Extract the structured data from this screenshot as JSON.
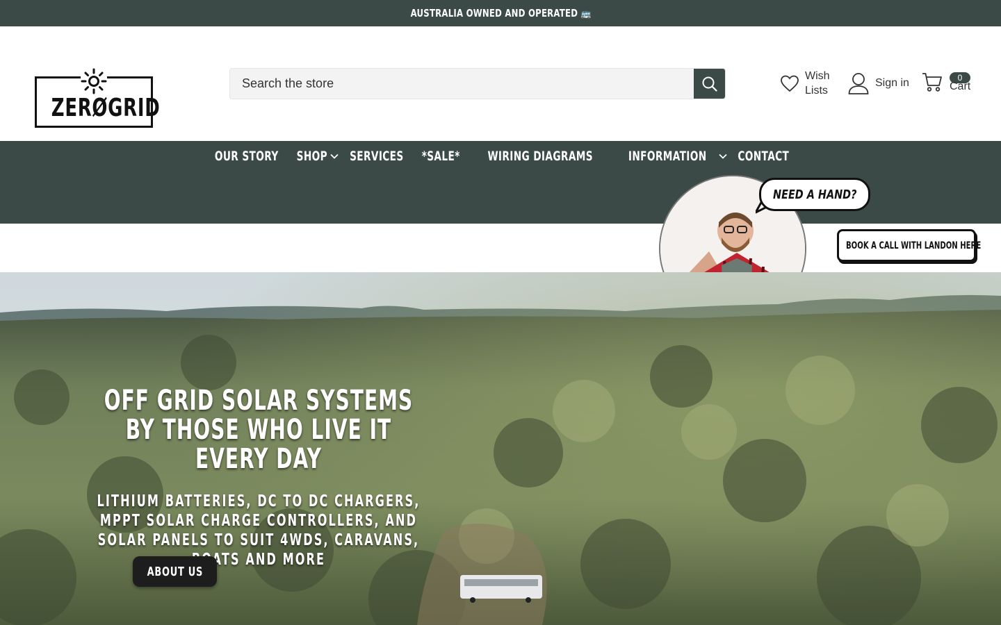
{
  "announcement": {
    "text": "AUSTRALIA OWNED AND OPERATED 🚌"
  },
  "brand": {
    "logo_text": "ZERØGRID"
  },
  "search": {
    "placeholder": "Search the store"
  },
  "header_actions": {
    "wishlist_line1": "Wish",
    "wishlist_line2": "Lists",
    "signin_label": "Sign in",
    "cart_label": "Cart",
    "cart_count": "0"
  },
  "nav": {
    "items": [
      {
        "label": "OUR STORY",
        "dropdown": false
      },
      {
        "label": "SHOP",
        "dropdown": true
      },
      {
        "label": "SERVICES",
        "dropdown": false
      },
      {
        "label": "*SALE*",
        "dropdown": false
      },
      {
        "label": "WIRING DIAGRAMS",
        "dropdown": false
      },
      {
        "label": "INFORMATION",
        "dropdown": true
      },
      {
        "label": "CONTACT",
        "dropdown": false
      }
    ]
  },
  "helper": {
    "bubble_text": "NEED A HAND?",
    "book_call_text": "BOOK A CALL WITH LANDON HERE"
  },
  "hero": {
    "title": "OFF GRID SOLAR SYSTEMS BY THOSE WHO LIVE IT EVERY DAY",
    "subtitle": "LITHIUM BATTERIES, DC TO DC CHARGERS, MPPT SOLAR CHARGE CONTROLLERS, AND SOLAR PANELS TO SUIT 4WDS, CARAVANS, BOATS AND MORE",
    "button_label": "ABOUT US"
  },
  "colors": {
    "brand_dark": "#3c4a47",
    "button_dark": "#1d1d1d",
    "white": "#ffffff"
  }
}
